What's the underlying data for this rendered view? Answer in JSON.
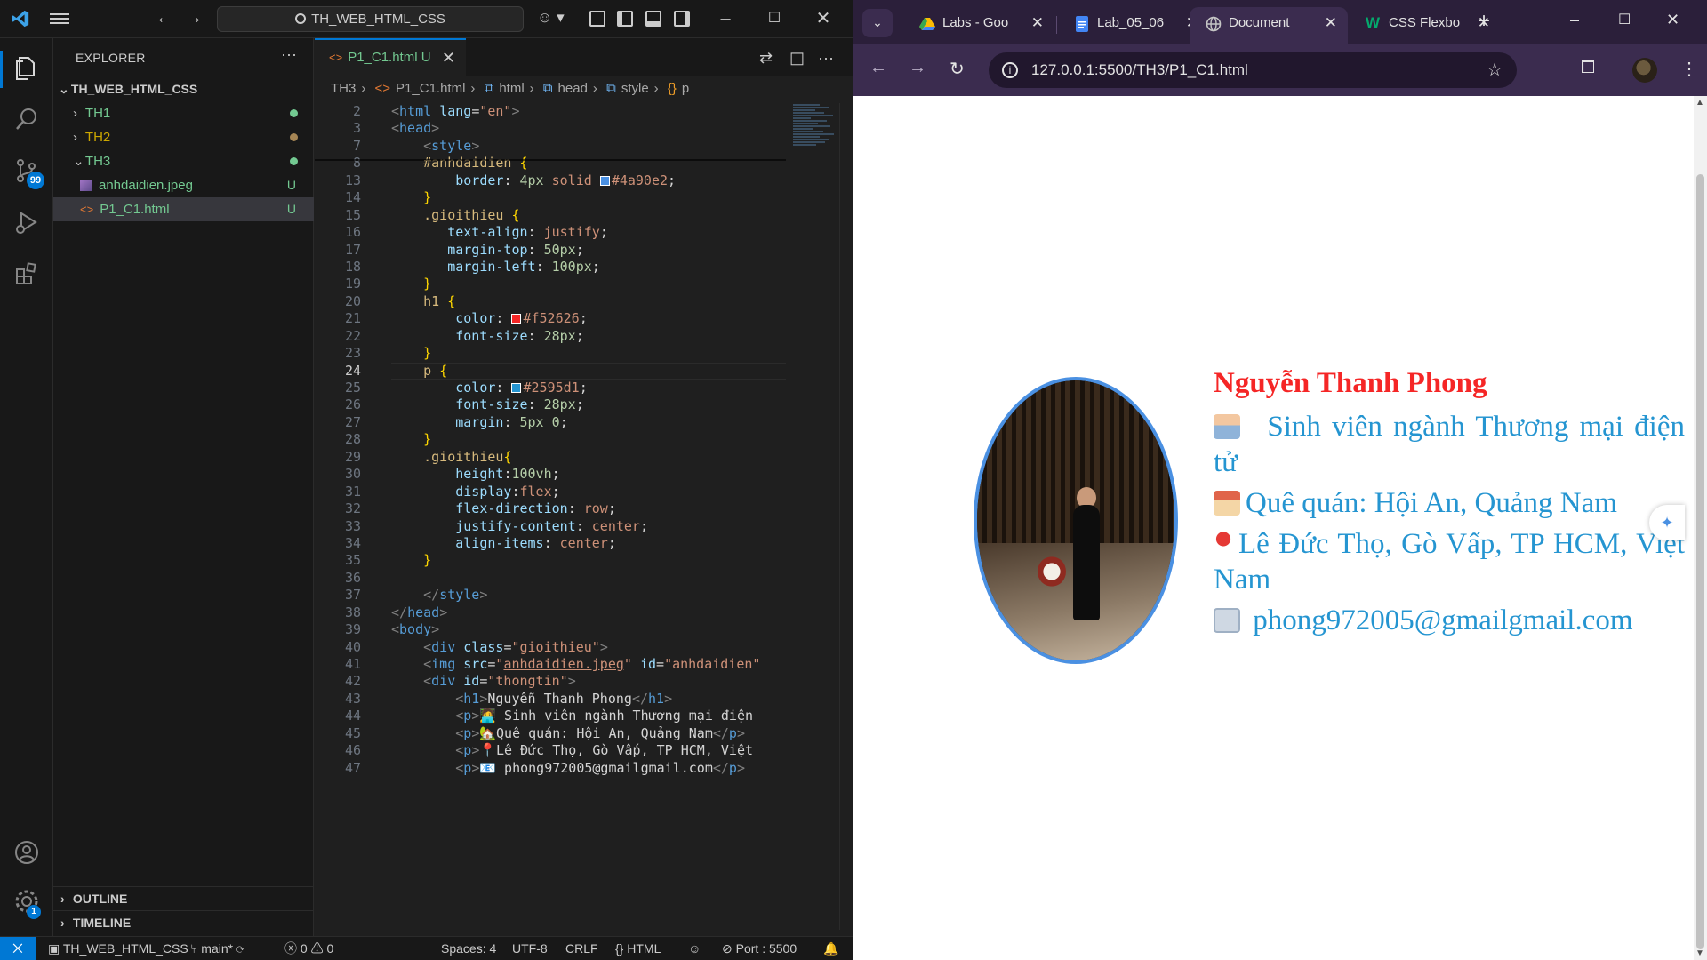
{
  "vscode": {
    "search_text": "TH_WEB_HTML_CSS",
    "explorer": {
      "title": "EXPLORER",
      "root": "TH_WEB_HTML_CSS",
      "folders": [
        {
          "label": "TH1",
          "status_color": "#73c991"
        },
        {
          "label": "TH2",
          "status_color": "#a58554"
        },
        {
          "label": "TH3",
          "status_color": "#73c991"
        }
      ],
      "files": [
        {
          "label": "anhdaidien.jpeg",
          "status": "U"
        },
        {
          "label": "P1_C1.html",
          "status": "U"
        }
      ],
      "outline": "OUTLINE",
      "timeline": "TIMELINE"
    },
    "activity": {
      "scm_badge": "99",
      "settings_badge": "1"
    },
    "tab": {
      "label": "P1_C1.html",
      "status": "U"
    },
    "breadcrumb": [
      "TH3",
      "P1_C1.html",
      "html",
      "head",
      "style",
      "p"
    ],
    "code_lines": [
      {
        "n": "2",
        "html": "<span class='k-br'>&lt;</span><span class='k-tag'>html</span> <span class='k-attr'>lang</span><span class='k-punc'>=</span><span class='k-str'>\"en\"</span><span class='k-br'>&gt;</span>"
      },
      {
        "n": "3",
        "html": "<span class='k-br'>&lt;</span><span class='k-tag'>head</span><span class='k-br'>&gt;</span>"
      },
      {
        "n": "7",
        "html": "    <span class='k-br'>&lt;</span><span class='k-tag'>style</span><span class='k-br'>&gt;</span>"
      },
      {
        "n": "8",
        "html": "    <span class='k-sel'>#anhdaidien</span> <span class='k-brace'>{</span>"
      },
      {
        "n": "13",
        "html": "        <span class='k-prop'>border</span><span class='k-punc'>: </span><span class='k-num'>4px</span> <span class='k-val'>solid</span> <span class='swatch' style='background:#4a90e2'></span><span class='k-val'>#4a90e2</span><span class='k-punc'>;</span>"
      },
      {
        "n": "14",
        "html": "    <span class='k-brace'>}</span>"
      },
      {
        "n": "15",
        "html": "    <span class='k-sel'>.gioithieu</span> <span class='k-brace'>{</span>"
      },
      {
        "n": "16",
        "html": "       <span class='k-prop'>text-align</span><span class='k-punc'>: </span><span class='k-val'>justify</span><span class='k-punc'>;</span>"
      },
      {
        "n": "17",
        "html": "       <span class='k-prop'>margin-top</span><span class='k-punc'>: </span><span class='k-num'>50px</span><span class='k-punc'>;</span>"
      },
      {
        "n": "18",
        "html": "       <span class='k-prop'>margin-left</span><span class='k-punc'>: </span><span class='k-num'>100px</span><span class='k-punc'>;</span>"
      },
      {
        "n": "19",
        "html": "    <span class='k-brace'>}</span>"
      },
      {
        "n": "20",
        "html": "    <span class='k-sel'>h1</span> <span class='k-brace'>{</span>"
      },
      {
        "n": "21",
        "html": "        <span class='k-prop'>color</span><span class='k-punc'>: </span><span class='swatch' style='background:#f52626'></span><span class='k-val'>#f52626</span><span class='k-punc'>;</span>"
      },
      {
        "n": "22",
        "html": "        <span class='k-prop'>font-size</span><span class='k-punc'>: </span><span class='k-num'>28px</span><span class='k-punc'>;</span>"
      },
      {
        "n": "23",
        "html": "    <span class='k-brace'>}</span>"
      },
      {
        "n": "24",
        "html": "    <span class='k-sel'>p</span> <span class='k-brace'>{</span>",
        "current": true
      },
      {
        "n": "25",
        "html": "        <span class='k-prop'>color</span><span class='k-punc'>: </span><span class='swatch' style='background:#2595d1'></span><span class='k-val'>#2595d1</span><span class='k-punc'>;</span>"
      },
      {
        "n": "26",
        "html": "        <span class='k-prop'>font-size</span><span class='k-punc'>: </span><span class='k-num'>28px</span><span class='k-punc'>;</span>"
      },
      {
        "n": "27",
        "html": "        <span class='k-prop'>margin</span><span class='k-punc'>: </span><span class='k-num'>5px 0</span><span class='k-punc'>;</span>"
      },
      {
        "n": "28",
        "html": "    <span class='k-brace'>}</span>"
      },
      {
        "n": "29",
        "html": "    <span class='k-sel'>.gioithieu</span><span class='k-brace'>{</span>"
      },
      {
        "n": "30",
        "html": "        <span class='k-prop'>height</span><span class='k-punc'>:</span><span class='k-num'>100vh</span><span class='k-punc'>;</span>"
      },
      {
        "n": "31",
        "html": "        <span class='k-prop'>display</span><span class='k-punc'>:</span><span class='k-val'>flex</span><span class='k-punc'>;</span>"
      },
      {
        "n": "32",
        "html": "        <span class='k-prop'>flex-direction</span><span class='k-punc'>: </span><span class='k-val'>row</span><span class='k-punc'>;</span>"
      },
      {
        "n": "33",
        "html": "        <span class='k-prop'>justify-content</span><span class='k-punc'>: </span><span class='k-val'>center</span><span class='k-punc'>;</span>"
      },
      {
        "n": "34",
        "html": "        <span class='k-prop'>align-items</span><span class='k-punc'>: </span><span class='k-val'>center</span><span class='k-punc'>;</span>"
      },
      {
        "n": "35",
        "html": "    <span class='k-brace'>}</span>"
      },
      {
        "n": "36",
        "html": ""
      },
      {
        "n": "37",
        "html": "    <span class='k-br'>&lt;/</span><span class='k-tag'>style</span><span class='k-br'>&gt;</span>"
      },
      {
        "n": "38",
        "html": "<span class='k-br'>&lt;/</span><span class='k-tag'>head</span><span class='k-br'>&gt;</span>"
      },
      {
        "n": "39",
        "html": "<span class='k-br'>&lt;</span><span class='k-tag'>body</span><span class='k-br'>&gt;</span>"
      },
      {
        "n": "40",
        "html": "    <span class='k-br'>&lt;</span><span class='k-tag'>div</span> <span class='k-attr'>class</span><span class='k-punc'>=</span><span class='k-str'>\"gioithieu\"</span><span class='k-br'>&gt;</span>"
      },
      {
        "n": "41",
        "html": "    <span class='k-br'>&lt;</span><span class='k-tag'>img</span> <span class='k-attr'>src</span><span class='k-punc'>=</span><span class='k-str'>\"<u>anhdaidien.jpeg</u>\"</span> <span class='k-attr'>id</span><span class='k-punc'>=</span><span class='k-str'>\"anhdaidien\"</span>"
      },
      {
        "n": "42",
        "html": "    <span class='k-br'>&lt;</span><span class='k-tag'>div</span> <span class='k-attr'>id</span><span class='k-punc'>=</span><span class='k-str'>\"thongtin\"</span><span class='k-br'>&gt;</span>"
      },
      {
        "n": "43",
        "html": "        <span class='k-br'>&lt;</span><span class='k-tag'>h1</span><span class='k-br'>&gt;</span><span class='k-txt'>Nguyễn Thanh Phong</span><span class='k-br'>&lt;/</span><span class='k-tag'>h1</span><span class='k-br'>&gt;</span>"
      },
      {
        "n": "44",
        "html": "        <span class='k-br'>&lt;</span><span class='k-tag'>p</span><span class='k-br'>&gt;</span><span class='k-txt'>🧑‍💻 Sinh viên ngành Thương mại điện</span>"
      },
      {
        "n": "45",
        "html": "        <span class='k-br'>&lt;</span><span class='k-tag'>p</span><span class='k-br'>&gt;</span><span class='k-txt'>🏡Quê quán: Hội An, Quảng Nam</span><span class='k-br'>&lt;/</span><span class='k-tag'>p</span><span class='k-br'>&gt;</span>"
      },
      {
        "n": "46",
        "html": "        <span class='k-br'>&lt;</span><span class='k-tag'>p</span><span class='k-br'>&gt;</span><span class='k-txt'>📍Lê Đức Thọ, Gò Vấp, TP HCM, Việt</span>"
      },
      {
        "n": "47",
        "html": "        <span class='k-br'>&lt;</span><span class='k-tag'>p</span><span class='k-br'>&gt;</span><span class='k-txt'>📧 phong972005@gmailgmail.com</span><span class='k-br'>&lt;/</span><span class='k-tag'>p</span><span class='k-br'>&gt;</span>"
      }
    ],
    "status": {
      "workspace": "TH_WEB_HTML_CSS",
      "branch": "main*",
      "errors": "0",
      "warnings": "0",
      "spaces": "Spaces: 4",
      "encoding": "UTF-8",
      "eol": "CRLF",
      "language": "HTML",
      "port": "Port : 5500"
    }
  },
  "chrome": {
    "tabs": [
      {
        "label": "Labs - Goo",
        "fav_color": "#34a853",
        "active": false
      },
      {
        "label": "Lab_05_06",
        "fav_color": "#4285f4",
        "active": false
      },
      {
        "label": "Document",
        "fav_color": "#9aa0a6",
        "active": true
      },
      {
        "label": "CSS Flexbo",
        "fav_color": "#04aa6d",
        "active": false
      }
    ],
    "url": "127.0.0.1:5500/TH3/P1_C1.html",
    "page": {
      "name": "Nguyễn Thanh Phong",
      "line1": "Sinh viên ngành Thương mại điện tử",
      "line2": "Quê quán: Hội An, Quảng Nam",
      "line3": "Lê Đức Thọ, Gò Vấp, TP HCM, Việt Nam",
      "line4": "phong972005@gmailgmail.com",
      "name_color": "#f52626",
      "text_color": "#2595d1",
      "border_color": "#4a90e2"
    }
  }
}
